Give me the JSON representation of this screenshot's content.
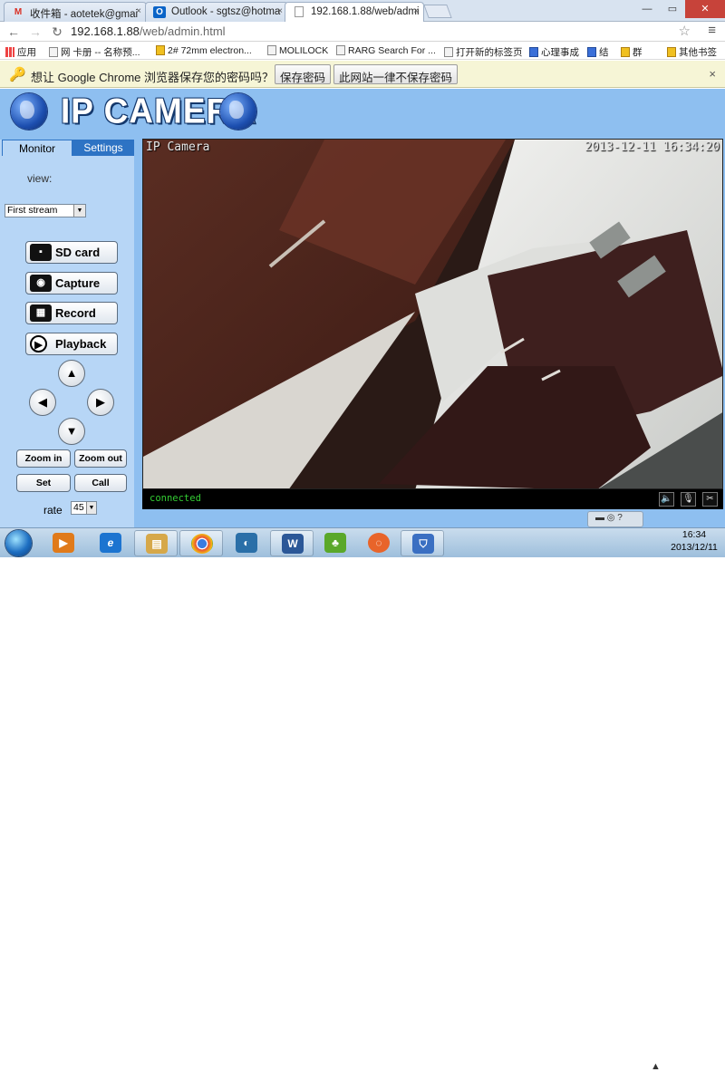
{
  "browser": {
    "tabs": [
      {
        "label": "收件箱 - aotetek@gmai",
        "icon": "gmail-icon",
        "icon_glyph": "M",
        "icon_color": "#d93025"
      },
      {
        "label": "Outlook - sgtsz@hotma",
        "icon": "outlook-icon",
        "icon_glyph": "O",
        "icon_color": "#0a64c8"
      },
      {
        "label": "192.168.1.88/web/admi",
        "icon": "page-icon",
        "icon_glyph": "▫",
        "icon_color": "#666666"
      }
    ],
    "tab_close": "×",
    "window_buttons": {
      "minimize": "—",
      "maximize": "▭",
      "close": "✕"
    },
    "nav": {
      "back": "←",
      "forward": "→",
      "reload": "↻"
    },
    "url_host": "192.168.1.88",
    "url_path": "/web/admin.html",
    "star": "☆",
    "menu": "≡",
    "bookmarks": [
      {
        "label": "应用"
      },
      {
        "label": "网 卡册 -- 名称预..."
      },
      {
        "label": "2# 72mm electron..."
      },
      {
        "label": "MOLILOCK"
      },
      {
        "label": "RARG Search For ..."
      },
      {
        "label": "打开新的标签页"
      },
      {
        "label": "心理事成"
      },
      {
        "label": "结"
      },
      {
        "label": "群"
      },
      {
        "label": "其他书签"
      }
    ],
    "password_bar": {
      "key_icon": "🔑",
      "message": "想让 Google Chrome 浏览器保存您的密码吗？",
      "save_button": "保存密码",
      "never_button": "此网站一律不保存密码",
      "close": "×"
    }
  },
  "page": {
    "title": "IP CAMERA",
    "tabs": [
      {
        "label": "Monitor"
      },
      {
        "label": "Settings"
      }
    ],
    "view_label": "view:",
    "stream_select": {
      "value": "First stream",
      "arrow": "▼"
    },
    "buttons": {
      "sd_card": "SD card",
      "capture": "Capture",
      "record": "Record",
      "playback": "Playback"
    },
    "button_icons": {
      "sd_card": "▪",
      "capture": "◉",
      "record": "▦",
      "playback": "▶"
    },
    "ptz": {
      "up": "▲",
      "down": "▼",
      "left": "◀",
      "right": "▶"
    },
    "zoom_in": "Zoom in",
    "zoom_out": "Zoom out",
    "set": "Set",
    "call": "Call",
    "rate_label": "rate",
    "rate_value": "45",
    "rate_arrow": "▼",
    "video": {
      "osd_title": "IP Camera",
      "osd_timestamp": "2013-12-11 16:34:20",
      "status": "connected",
      "controls": {
        "mute": "🔈",
        "mic": "🎙",
        "settings": "✂"
      }
    }
  },
  "taskbar": {
    "items": [
      {
        "name": "media-player",
        "glyph": "▶",
        "color": "#e07a1a"
      },
      {
        "name": "internet-explorer",
        "glyph": "e",
        "color": "#1c74d0"
      },
      {
        "name": "file-explorer",
        "glyph": "▤",
        "color": "#d6a84a"
      },
      {
        "name": "chrome",
        "glyph": "◎",
        "color": "#3a8f3a"
      },
      {
        "name": "app-globe",
        "glyph": "◐",
        "color": "#2a6fa8"
      },
      {
        "name": "word",
        "glyph": "W",
        "color": "#2b5797"
      },
      {
        "name": "app-green",
        "glyph": "♣",
        "color": "#5aa82a"
      },
      {
        "name": "app-orange",
        "glyph": "◌",
        "color": "#e8642a"
      },
      {
        "name": "security-center",
        "glyph": "⛉",
        "color": "#3a6fc2"
      }
    ],
    "clock_time": "16:34",
    "clock_date": "2013/12/11",
    "tray_icons": "▬ ◎ ?"
  },
  "colors": {
    "page_bg": "#8ebff0",
    "panel_bg": "#b7d6f6",
    "tab_active": "#2d73c4",
    "status_green": "#33cc33"
  }
}
